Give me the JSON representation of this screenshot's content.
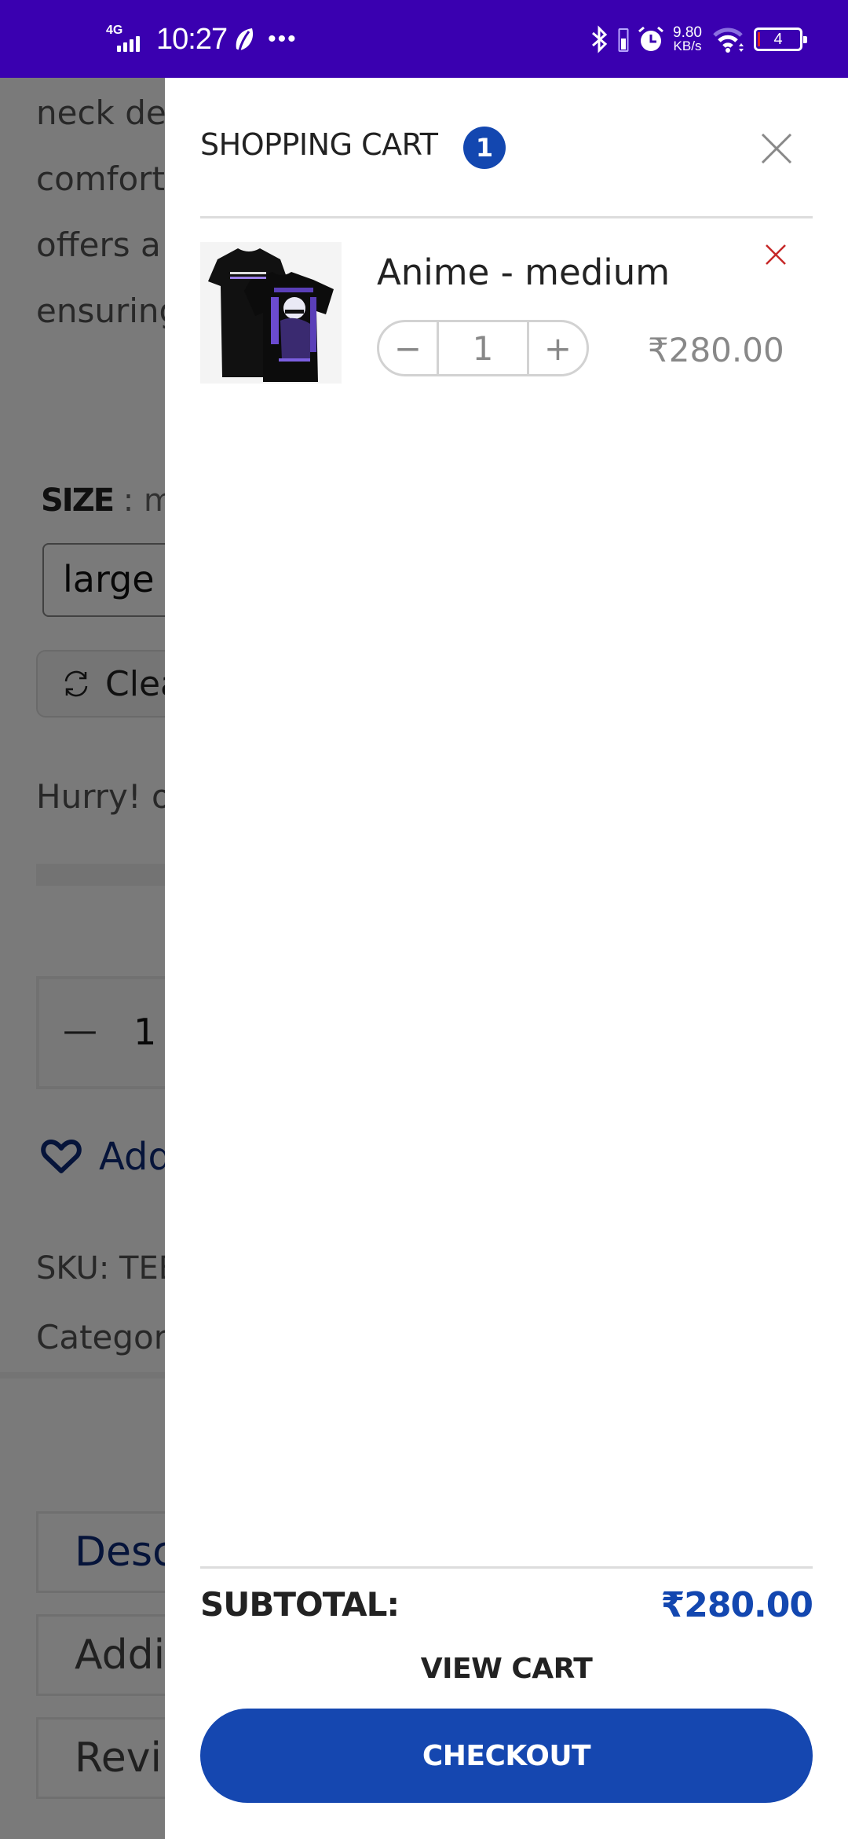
{
  "status_bar": {
    "network_type": "4G",
    "time": "10:27",
    "overflow": "•••",
    "speed_value": "9.80",
    "speed_unit": "KB/s",
    "battery_level": "4",
    "colors": {
      "background": "#3a00b0"
    }
  },
  "background_page": {
    "description_lines": [
      "neck de",
      "comfort",
      "offers a",
      "ensuring"
    ],
    "size_label": "SIZE",
    "size_sep": " : ",
    "size_value": "me",
    "size_select_value": "large",
    "clear_label": "Clea",
    "stock_text": "Hurry! o",
    "quantity_minus": "—",
    "quantity_value": "1",
    "wishlist_label": "Add",
    "sku_text": "SKU: TEE",
    "category_text": "Categor",
    "tabs": [
      {
        "label": "Desc",
        "active": true
      },
      {
        "label": "Addi",
        "active": false
      },
      {
        "label": "Revi",
        "active": false
      }
    ]
  },
  "cart_drawer": {
    "title": "SHOPPING CART",
    "count": "1",
    "items": [
      {
        "name": "Anime - medium",
        "quantity": "1",
        "minus": "−",
        "plus": "+",
        "price": "₹280.00",
        "image_icon": "tshirt-image"
      }
    ],
    "subtotal_label": "SUBTOTAL:",
    "subtotal_value": "₹280.00",
    "view_cart_label": "VIEW CART",
    "checkout_label": "CHECKOUT",
    "colors": {
      "accent": "#1347b0",
      "remove": "#c62828"
    }
  }
}
